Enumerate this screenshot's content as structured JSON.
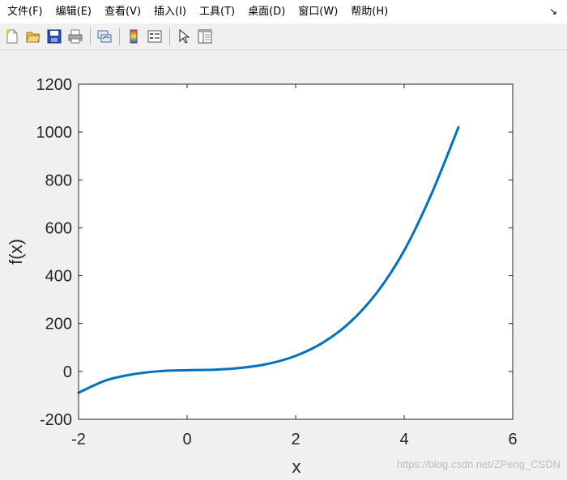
{
  "menubar": {
    "items": [
      "文件(F)",
      "编辑(E)",
      "查看(V)",
      "插入(I)",
      "工具(T)",
      "桌面(D)",
      "窗口(W)",
      "帮助(H)"
    ],
    "dock_glyph": "↘"
  },
  "toolbar": {
    "buttons": [
      "new-figure-icon",
      "open-file-icon",
      "save-icon",
      "print-icon",
      "link-plot-icon",
      "colorbar-icon",
      "legend-icon",
      "edit-plot-arrow-icon",
      "property-inspector-icon"
    ]
  },
  "chart_data": {
    "type": "line",
    "title": "",
    "xlabel": "x",
    "ylabel": "f(x)",
    "xlim": [
      -2,
      6
    ],
    "ylim": [
      -200,
      1200
    ],
    "xticks": [
      "-2",
      "0",
      "2",
      "4",
      "6"
    ],
    "yticks": [
      "-200",
      "0",
      "200",
      "400",
      "600",
      "800",
      "1000",
      "1200"
    ],
    "grid": false,
    "series": [
      {
        "color": "#0072bd",
        "x": [
          -2,
          -1.5,
          -1,
          -0.5,
          0,
          0.5,
          1,
          1.5,
          2,
          2.5,
          3,
          3.5,
          4,
          4.5,
          5
        ],
        "y": [
          -89,
          -38,
          -12,
          1,
          5,
          7,
          15,
          32,
          65,
          120,
          205,
          330,
          505,
          740,
          1020
        ]
      }
    ]
  },
  "watermark": "https://blog.csdn.net/ZPeng_CSDN"
}
